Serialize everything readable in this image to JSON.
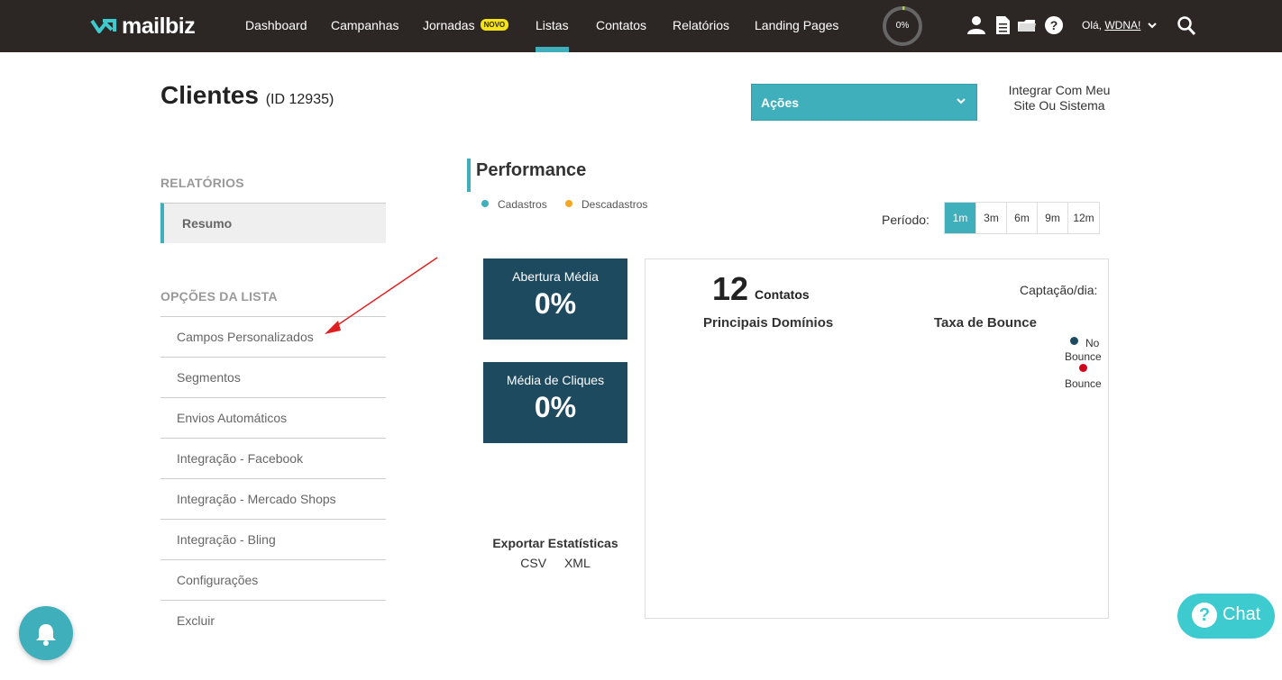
{
  "brand": {
    "name": "mailbiz",
    "accent": "#3eafbb",
    "dark": "#2c2725"
  },
  "nav": {
    "items": [
      {
        "label": "Dashboard"
      },
      {
        "label": "Campanhas"
      },
      {
        "label": "Jornadas",
        "badge": "NOVO"
      },
      {
        "label": "Listas",
        "active": true
      },
      {
        "label": "Contatos"
      },
      {
        "label": "Relatórios"
      },
      {
        "label": "Landing Pages"
      }
    ],
    "progress_label": "0%",
    "progress_value": 0.02,
    "icons": [
      "user-icon",
      "document-icon",
      "folder-icon",
      "help-icon",
      "search-icon"
    ],
    "greeting": "Olá,",
    "username": "WDNA!"
  },
  "header": {
    "title": "Clientes",
    "id_label": "(ID 12935)",
    "actions_label": "Ações",
    "integrate_line1": "Integrar Com Meu",
    "integrate_line2": "Site Ou Sistema"
  },
  "sidebar": {
    "reports_heading": "RELATÓRIOS",
    "reports_items": [
      {
        "label": "Resumo",
        "active": true
      }
    ],
    "options_heading": "OPÇÕES DA LISTA",
    "options_items": [
      {
        "label": "Campos Personalizados"
      },
      {
        "label": "Segmentos"
      },
      {
        "label": "Envios Automáticos"
      },
      {
        "label": "Integração - Facebook"
      },
      {
        "label": "Integração - Mercado Shops"
      },
      {
        "label": "Integração - Bling"
      },
      {
        "label": "Configurações"
      },
      {
        "label": "Excluir"
      }
    ]
  },
  "performance": {
    "title": "Performance",
    "legend": [
      {
        "label": "Cadastros",
        "color": "#3eafbb"
      },
      {
        "label": "Descadastros",
        "color": "#f5a623"
      }
    ],
    "period_label": "Período:",
    "periods": [
      "1m",
      "3m",
      "6m",
      "9m",
      "12m"
    ],
    "active_period": "1m",
    "stats": [
      {
        "title": "Abertura Média",
        "value": "0%"
      },
      {
        "title": "Média de Cliques",
        "value": "0%"
      }
    ],
    "export": {
      "title": "Exportar Estatísticas",
      "csv": "CSV",
      "xml": "XML"
    },
    "contacts_count": "12",
    "contacts_label": "Contatos",
    "capture_label": "Captação/dia:",
    "domains_title": "Principais Domínios",
    "bounce_title": "Taxa de Bounce",
    "bounce_legend": [
      {
        "label": "No",
        "label2": "Bounce",
        "color": "#1e4a60"
      },
      {
        "label": "Bounce",
        "color": "#d0021b"
      }
    ]
  },
  "widgets": {
    "chat_label": "Chat",
    "chat_q": "?"
  }
}
